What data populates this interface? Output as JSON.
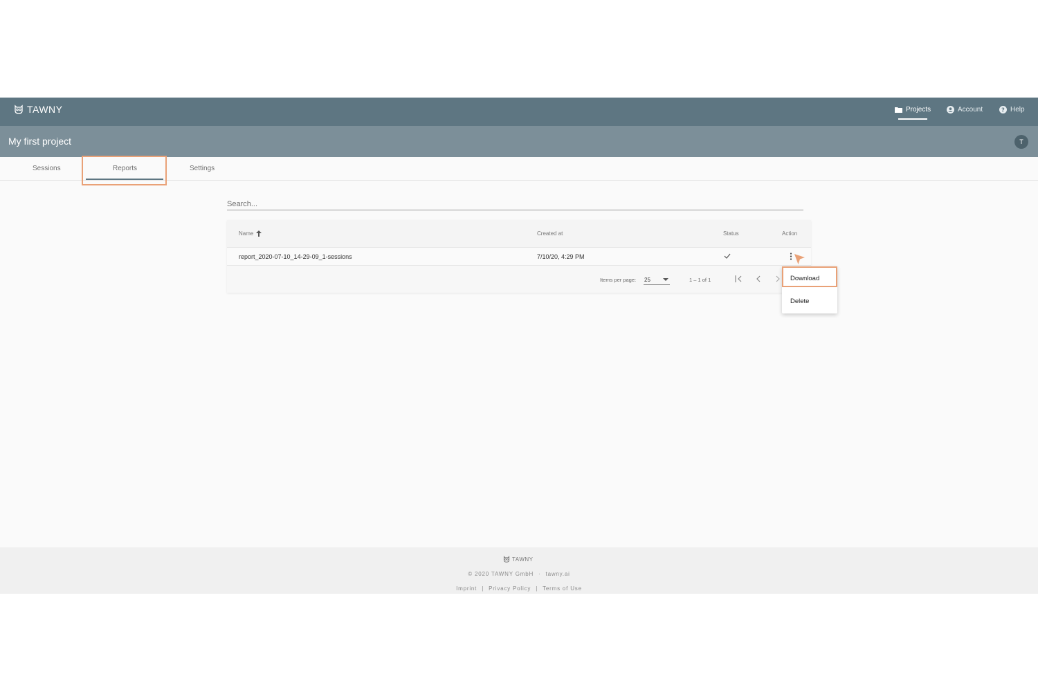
{
  "app": {
    "brand": "TAWNY"
  },
  "topnav": {
    "projects": "Projects",
    "account": "Account",
    "help": "Help"
  },
  "project": {
    "title": "My first project",
    "avatar_initial": "T"
  },
  "tabs": [
    {
      "label": "Sessions"
    },
    {
      "label": "Reports"
    },
    {
      "label": "Settings"
    }
  ],
  "search": {
    "placeholder": "Search..."
  },
  "table": {
    "headers": {
      "name": "Name",
      "created": "Created at",
      "status": "Status",
      "action": "Action"
    },
    "rows": [
      {
        "name": "report_2020-07-10_14-29-09_1-sessions",
        "created": "7/10/20, 4:29 PM"
      }
    ],
    "items_per_page_label": "Items per page:",
    "items_per_page_value": "25",
    "range": "1 – 1 of 1"
  },
  "menu": {
    "download": "Download",
    "delete": "Delete"
  },
  "footer": {
    "brand": "TAWNY",
    "copyright": "© 2020 TAWNY GmbH",
    "sep": "·",
    "site": "tawny.ai",
    "imprint": "Imprint",
    "pipe": "|",
    "privacy": "Privacy Policy",
    "terms": "Terms of Use"
  },
  "colors": {
    "topbar": "#5e7682",
    "projbar": "#7c8f99",
    "highlight": "#e9a177"
  }
}
